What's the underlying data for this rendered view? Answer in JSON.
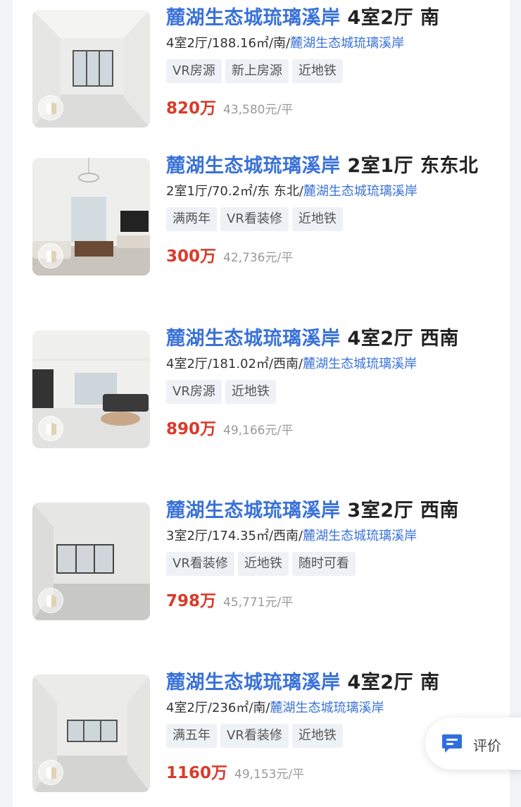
{
  "listings": [
    {
      "community": "麓湖生态城琉璃溪岸",
      "layout_title": "4室2厅 南",
      "meta_prefix": "4室2厅/188.16㎡/南/",
      "meta_link": "麓湖生态城琉璃溪岸",
      "tags": [
        "VR房源",
        "新上房源",
        "近地铁"
      ],
      "price": "820万",
      "unit_price": "43,580元/平"
    },
    {
      "community": "麓湖生态城琉璃溪岸",
      "layout_title": "2室1厅 东东北",
      "meta_prefix": "2室1厅/70.2㎡/东 东北/",
      "meta_link": "麓湖生态城琉璃溪岸",
      "tags": [
        "满两年",
        "VR看装修",
        "近地铁"
      ],
      "price": "300万",
      "unit_price": "42,736元/平"
    },
    {
      "community": "麓湖生态城琉璃溪岸",
      "layout_title": "4室2厅 西南",
      "meta_prefix": "4室2厅/181.02㎡/西南/",
      "meta_link": "麓湖生态城琉璃溪岸",
      "tags": [
        "VR房源",
        "近地铁"
      ],
      "price": "890万",
      "unit_price": "49,166元/平"
    },
    {
      "community": "麓湖生态城琉璃溪岸",
      "layout_title": "3室2厅 西南",
      "meta_prefix": "3室2厅/174.35㎡/西南/",
      "meta_link": "麓湖生态城琉璃溪岸",
      "tags": [
        "VR看装修",
        "近地铁",
        "随时可看"
      ],
      "price": "798万",
      "unit_price": "45,771元/平"
    },
    {
      "community": "麓湖生态城琉璃溪岸",
      "layout_title": "4室2厅 南",
      "meta_prefix": "4室2厅/236㎡/南/",
      "meta_link": "麓湖生态城琉璃溪岸",
      "tags": [
        "满五年",
        "VR看装修",
        "近地铁"
      ],
      "price": "1160万",
      "unit_price": "49,153元/平"
    }
  ],
  "review_button": {
    "label": "评价",
    "icon": "chat-icon"
  },
  "colors": {
    "link": "#3a72d8",
    "price": "#d93a2b",
    "tag_bg": "#eef1f5"
  }
}
